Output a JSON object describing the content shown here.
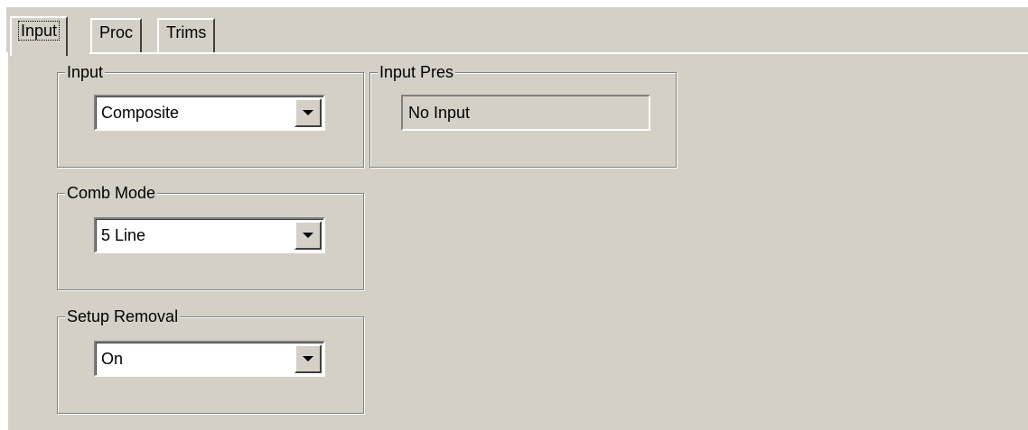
{
  "tabs": [
    {
      "label": "Input",
      "active": true
    },
    {
      "label": "Proc",
      "active": false
    },
    {
      "label": "Trims",
      "active": false
    }
  ],
  "groups": {
    "input": {
      "label": "Input",
      "selected": "Composite"
    },
    "input_pres": {
      "label": "Input Pres",
      "value": "No Input"
    },
    "comb_mode": {
      "label": "Comb Mode",
      "selected": "5 Line"
    },
    "setup_removal": {
      "label": "Setup Removal",
      "selected": "On"
    }
  },
  "icons": {
    "dropdown": "chevron-down-icon"
  },
  "colors": {
    "face": "#d4d0c8",
    "highlight": "#ffffff",
    "shadow": "#808080"
  }
}
